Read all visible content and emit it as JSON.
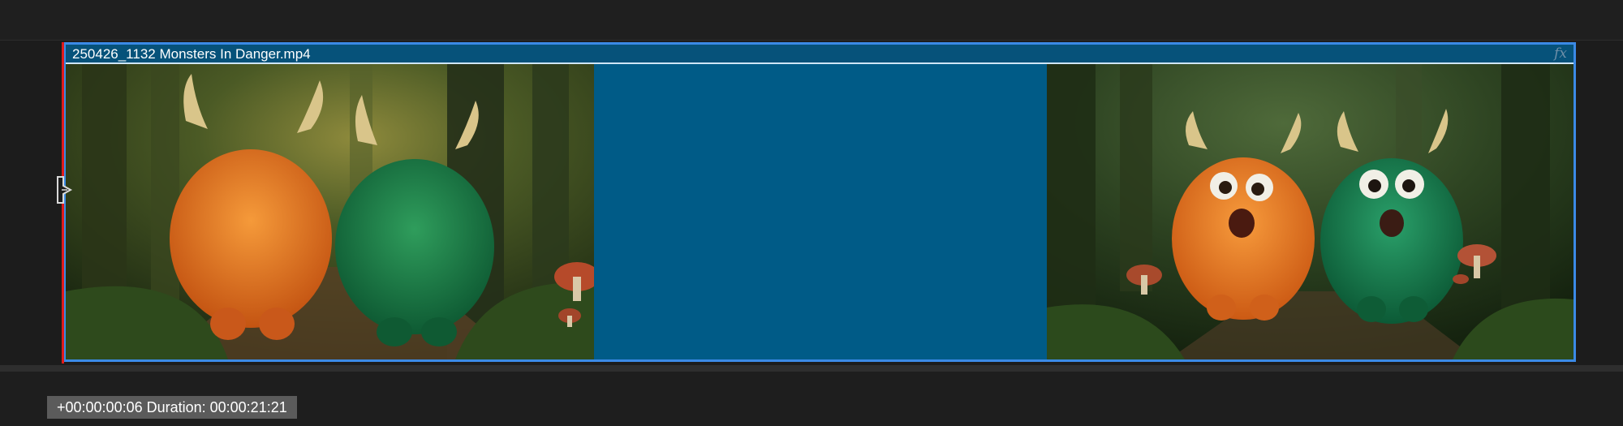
{
  "clip": {
    "title": "250426_1132 Monsters In Danger.mp4",
    "fx_label": "fx",
    "accent_color": "#3b8ae6",
    "clip_color": "#005b87",
    "playhead_color": "#e01b1b"
  },
  "thumbnails": [
    {
      "name": "thumbnail-monsters-walking-away"
    },
    {
      "name": "thumbnail-monsters-surprised"
    }
  ],
  "icons": {
    "trim_handle": "trim-in-handle-icon"
  },
  "status": {
    "timecode_text": "+00:00:00:06 Duration: 00:00:21:21"
  }
}
